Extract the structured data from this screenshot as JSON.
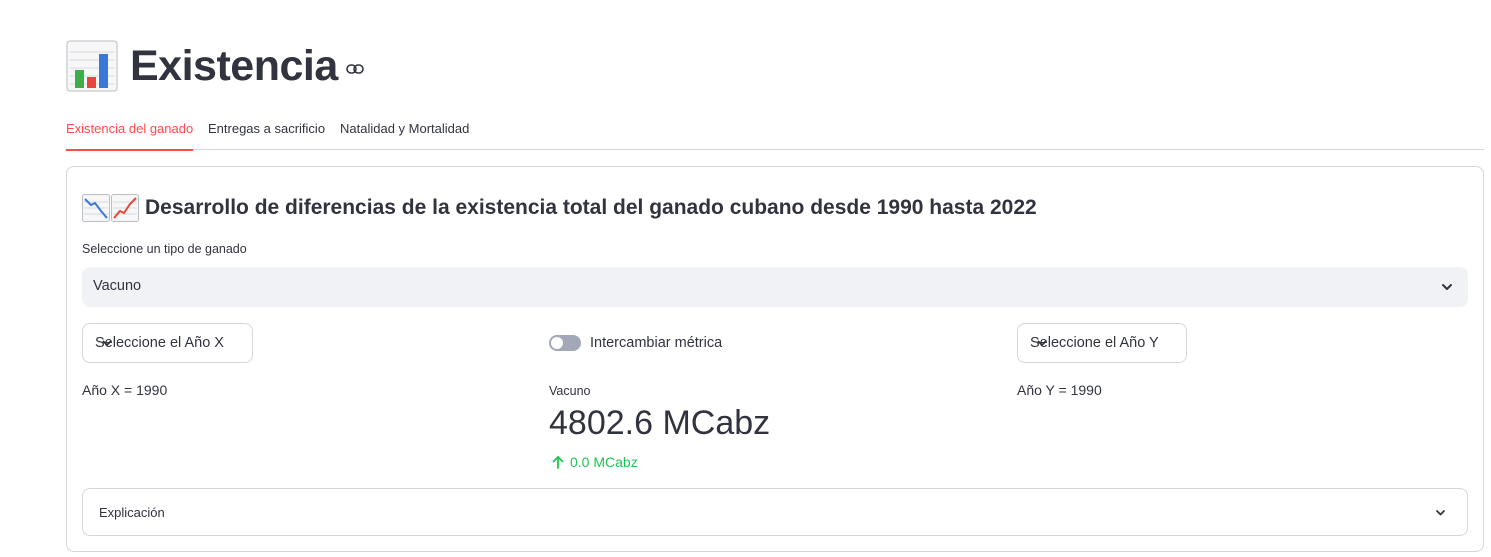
{
  "header": {
    "title": "Existencia",
    "emoji_icon": "bar-chart-emoji",
    "anchor_icon": "link-icon"
  },
  "tabs": [
    {
      "label": "Existencia del ganado",
      "active": true
    },
    {
      "label": "Entregas a sacrificio",
      "active": false
    },
    {
      "label": "Natalidad y Mortalidad",
      "active": false
    }
  ],
  "section": {
    "heading": "Desarrollo de diferencias de la existencia total del ganado cubano desde 1990 hasta 2022",
    "heading_icons": [
      "chart-decreasing-emoji",
      "chart-increasing-emoji"
    ]
  },
  "livestock_select": {
    "label": "Seleccione un tipo de ganado",
    "value": "Vacuno"
  },
  "year_x_select": {
    "label": "Seleccione el Año X"
  },
  "year_y_select": {
    "label": "Seleccione el Año Y"
  },
  "swap_toggle": {
    "label": "Intercambiar métrica",
    "checked": false
  },
  "year_x_text": "Año X = 1990",
  "year_y_text": "Año Y = 1990",
  "metric": {
    "label": "Vacuno",
    "value": "4802.6 MCabz",
    "delta": "0.0 MCabz",
    "delta_direction": "up"
  },
  "expander": {
    "label": "Explicación",
    "expanded": false
  },
  "colors": {
    "accent": "#ff4b4b",
    "text": "#31333f",
    "delta_positive": "#21c354",
    "border": "#d6d6d9",
    "input_bg": "#f0f2f6"
  }
}
